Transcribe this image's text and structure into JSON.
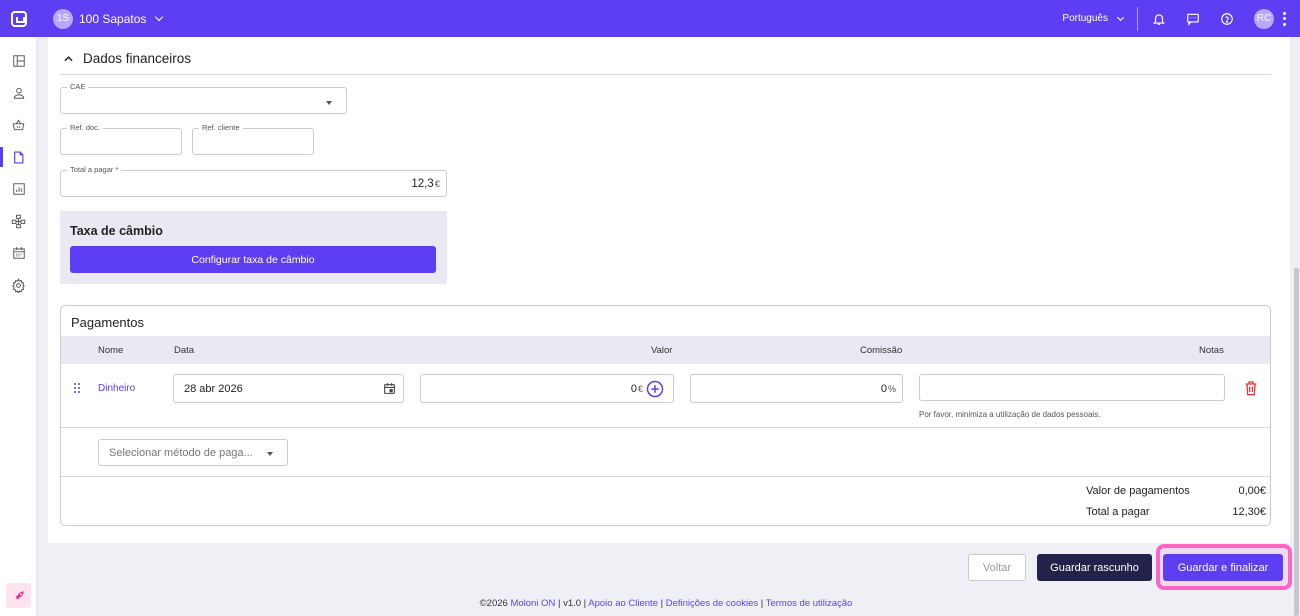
{
  "topbar": {
    "company_initials": "1S",
    "company_name": "100 Sapatos",
    "language": "Português",
    "user_initials": "RC"
  },
  "sidebar": {
    "items": [
      "dashboard",
      "contacts",
      "products",
      "documents",
      "reports",
      "structure",
      "calendar",
      "settings"
    ],
    "active": "documents"
  },
  "financial": {
    "section_title": "Dados financeiros",
    "cae_label": "CAE",
    "cae_value": "",
    "ref_doc_label": "Ref. doc.",
    "ref_doc_value": "",
    "ref_client_label": "Ref. cliente",
    "ref_client_value": "",
    "total_label": "Total a pagar *",
    "total_value": "12,3",
    "currency": "€",
    "fx_title": "Taxa de câmbio",
    "fx_button": "Configurar taxa de câmbio"
  },
  "payments": {
    "title": "Pagamentos",
    "columns": {
      "name": "Nome",
      "date": "Data",
      "value": "Valor",
      "commission": "Comissão",
      "notes": "Notas"
    },
    "row": {
      "method": "Dinheiro",
      "date": "28 abr 2026",
      "value": "0",
      "value_unit": "€",
      "commission": "0",
      "commission_unit": "%",
      "notes": "",
      "notes_hint": "Por favor, minimiza a utilização de dados pessoais."
    },
    "add_method_placeholder": "Selecionar método de paga...",
    "totals": {
      "payments_label": "Valor de pagamentos",
      "payments_value": "0,00€",
      "total_label": "Total a pagar",
      "total_value": "12,30€"
    }
  },
  "actions": {
    "back": "Voltar",
    "save_draft": "Guardar rascunho",
    "save_finalize": "Guardar e finalizar"
  },
  "footer": {
    "copyright": "©2026",
    "brand": "Moloni ON",
    "version": "v1.0",
    "support": "Apoio ao Cliente",
    "cookies": "Definições de cookies",
    "terms": "Termos de utilização"
  },
  "colors": {
    "brand": "#5d3ef2",
    "dark_button": "#22224a",
    "highlight": "#ff66c4",
    "danger": "#e53935"
  }
}
